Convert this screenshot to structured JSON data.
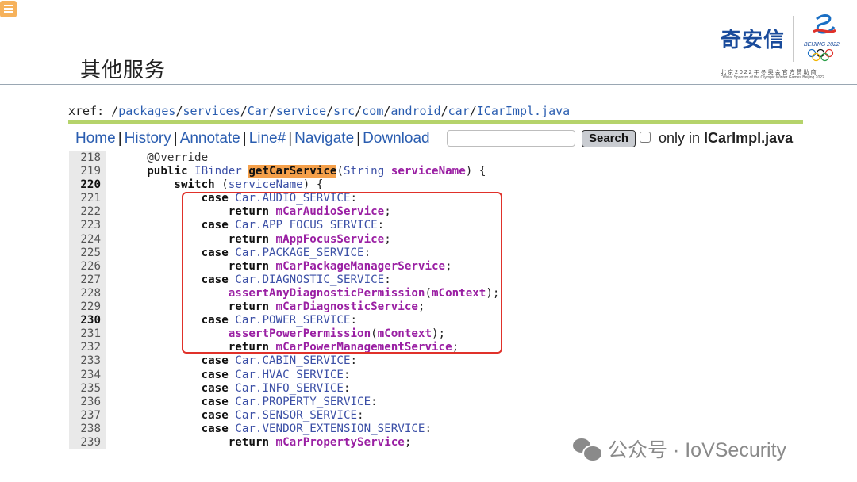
{
  "slide": {
    "title": "其他服务"
  },
  "header": {
    "company_logo": "奇安信",
    "emblem_text": "BEIJING 2022",
    "sponsor_cn": "北京2022年冬奥会官方赞助商",
    "sponsor_en": "Official Sponsor of the Olympic Winter Games Beijing 2022"
  },
  "xref": {
    "label": "xref: ",
    "path": [
      {
        "sep": "/",
        "part": "packages"
      },
      {
        "sep": "/",
        "part": "services"
      },
      {
        "sep": "/",
        "part": "Car"
      },
      {
        "sep": "/",
        "part": "service"
      },
      {
        "sep": "/",
        "part": "src"
      },
      {
        "sep": "/",
        "part": "com"
      },
      {
        "sep": "/",
        "part": "android"
      },
      {
        "sep": "/",
        "part": "car"
      },
      {
        "sep": "/",
        "part": "ICarImpl.java"
      }
    ]
  },
  "nav": {
    "links": [
      "Home",
      "History",
      "Annotate",
      "Line#",
      "Navigate",
      "Download"
    ],
    "search_value": "",
    "search_button": "Search",
    "only_in_prefix": "only in ",
    "only_in_file": "ICarImpl.java"
  },
  "code": {
    "lines": [
      {
        "n": "218",
        "bold": false
      },
      {
        "n": "219",
        "bold": false
      },
      {
        "n": "220",
        "bold": true
      },
      {
        "n": "221",
        "bold": false
      },
      {
        "n": "222",
        "bold": false
      },
      {
        "n": "223",
        "bold": false
      },
      {
        "n": "224",
        "bold": false
      },
      {
        "n": "225",
        "bold": false
      },
      {
        "n": "226",
        "bold": false
      },
      {
        "n": "227",
        "bold": false
      },
      {
        "n": "228",
        "bold": false
      },
      {
        "n": "229",
        "bold": false
      },
      {
        "n": "230",
        "bold": true
      },
      {
        "n": "231",
        "bold": false
      },
      {
        "n": "232",
        "bold": false
      },
      {
        "n": "233",
        "bold": false
      },
      {
        "n": "234",
        "bold": false
      },
      {
        "n": "235",
        "bold": false
      },
      {
        "n": "236",
        "bold": false
      },
      {
        "n": "237",
        "bold": false
      },
      {
        "n": "238",
        "bold": false
      },
      {
        "n": "239",
        "bold": false
      }
    ],
    "tokens": {
      "l218": [
        [
          "anno",
          "      @Override"
        ]
      ],
      "l219": [
        [
          "kw",
          "      public "
        ],
        [
          "type",
          "IBinder "
        ],
        [
          "hl",
          "getCarService"
        ],
        [
          "plain",
          "("
        ],
        [
          "type",
          "String "
        ],
        [
          "fld",
          "serviceName"
        ],
        [
          "plain",
          ") {"
        ]
      ],
      "l220": [
        [
          "kw",
          "          switch "
        ],
        [
          "plain",
          "("
        ],
        [
          "const",
          "serviceName"
        ],
        [
          "plain",
          ") {"
        ]
      ],
      "l221": [
        [
          "kw",
          "              case "
        ],
        [
          "const",
          "Car.AUDIO_SERVICE"
        ],
        [
          "plain",
          ":"
        ]
      ],
      "l222": [
        [
          "kw",
          "                  return "
        ],
        [
          "fld",
          "mCarAudioService"
        ],
        [
          "plain",
          ";"
        ]
      ],
      "l223": [
        [
          "kw",
          "              case "
        ],
        [
          "const",
          "Car.APP_FOCUS_SERVICE"
        ],
        [
          "plain",
          ":"
        ]
      ],
      "l224": [
        [
          "kw",
          "                  return "
        ],
        [
          "fld",
          "mAppFocusService"
        ],
        [
          "plain",
          ";"
        ]
      ],
      "l225": [
        [
          "kw",
          "              case "
        ],
        [
          "const",
          "Car.PACKAGE_SERVICE"
        ],
        [
          "plain",
          ":"
        ]
      ],
      "l226": [
        [
          "kw",
          "                  return "
        ],
        [
          "fld",
          "mCarPackageManagerService"
        ],
        [
          "plain",
          ";"
        ]
      ],
      "l227": [
        [
          "kw",
          "              case "
        ],
        [
          "const",
          "Car.DIAGNOSTIC_SERVICE"
        ],
        [
          "plain",
          ":"
        ]
      ],
      "l228": [
        [
          "plain",
          "                  "
        ],
        [
          "fn",
          "assertAnyDiagnosticPermission"
        ],
        [
          "plain",
          "("
        ],
        [
          "fld",
          "mContext"
        ],
        [
          "plain",
          ");"
        ]
      ],
      "l229": [
        [
          "kw",
          "                  return "
        ],
        [
          "fld",
          "mCarDiagnosticService"
        ],
        [
          "plain",
          ";"
        ]
      ],
      "l230": [
        [
          "kw",
          "              case "
        ],
        [
          "const",
          "Car.POWER_SERVICE"
        ],
        [
          "plain",
          ":"
        ]
      ],
      "l231": [
        [
          "plain",
          "                  "
        ],
        [
          "fn",
          "assertPowerPermission"
        ],
        [
          "plain",
          "("
        ],
        [
          "fld",
          "mContext"
        ],
        [
          "plain",
          ");"
        ]
      ],
      "l232": [
        [
          "kw",
          "                  return "
        ],
        [
          "fld",
          "mCarPowerManagementService"
        ],
        [
          "plain",
          ";"
        ]
      ],
      "l233": [
        [
          "kw",
          "              case "
        ],
        [
          "const",
          "Car.CABIN_SERVICE"
        ],
        [
          "plain",
          ":"
        ]
      ],
      "l234": [
        [
          "kw",
          "              case "
        ],
        [
          "const",
          "Car.HVAC_SERVICE"
        ],
        [
          "plain",
          ":"
        ]
      ],
      "l235": [
        [
          "kw",
          "              case "
        ],
        [
          "const",
          "Car.INFO_SERVICE"
        ],
        [
          "plain",
          ":"
        ]
      ],
      "l236": [
        [
          "kw",
          "              case "
        ],
        [
          "const",
          "Car.PROPERTY_SERVICE"
        ],
        [
          "plain",
          ":"
        ]
      ],
      "l237": [
        [
          "kw",
          "              case "
        ],
        [
          "const",
          "Car.SENSOR_SERVICE"
        ],
        [
          "plain",
          ":"
        ]
      ],
      "l238": [
        [
          "kw",
          "              case "
        ],
        [
          "const",
          "Car.VENDOR_EXTENSION_SERVICE"
        ],
        [
          "plain",
          ":"
        ]
      ],
      "l239": [
        [
          "kw",
          "                  return "
        ],
        [
          "fld",
          "mCarPropertyService"
        ],
        [
          "plain",
          ";"
        ]
      ]
    }
  },
  "watermark": {
    "text": "公众号 · IoVSecurity"
  },
  "colors": {
    "accent_highlight": "#f5a04a",
    "highlight_box": "#e0312a",
    "xref_rule": "#b5d36b",
    "link": "#2a5db0",
    "field": "#9a1fa3"
  }
}
